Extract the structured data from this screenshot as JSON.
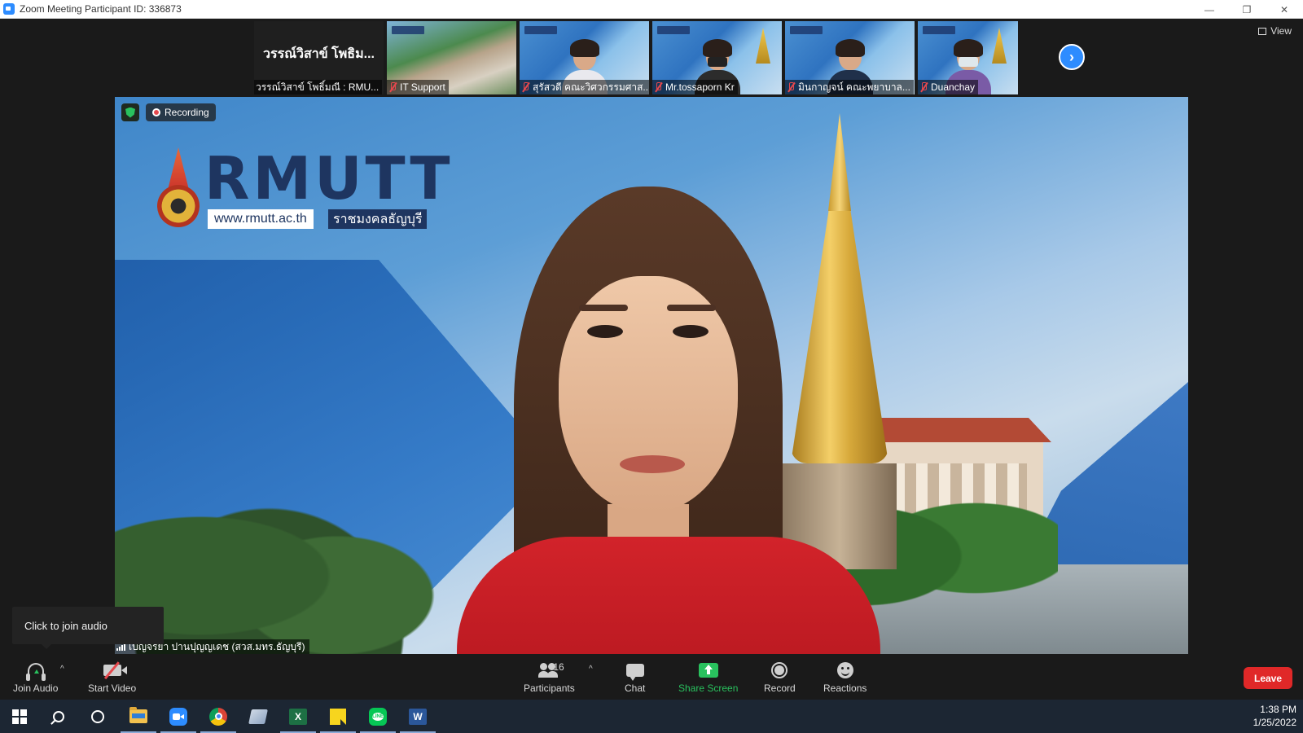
{
  "window": {
    "title": "Zoom Meeting Participant ID: 336873",
    "minimize": "—",
    "restore": "❐",
    "close": "✕"
  },
  "thumbnails": [
    {
      "name": "วรรณ์วิสาข์ โพธิ์มณี : RMU...",
      "big_name": "วรรณ์วิสาข์ โพธิม...",
      "type": "name-only"
    },
    {
      "name": "IT Support",
      "type": "campus",
      "active": true
    },
    {
      "name": "สุรัสวดี คณะวิศวกรรมศาส...",
      "type": "person"
    },
    {
      "name": "Mr.tossaporn Kr",
      "type": "person"
    },
    {
      "name": "มินกาญจน์ คณะพยาบาล...",
      "type": "person"
    },
    {
      "name": "Duanchay",
      "type": "person"
    }
  ],
  "next_button": "›",
  "view_button": "View",
  "main_video": {
    "recording_label": "Recording",
    "speaker_name": "เบญจิรัยา ปานปุญญเดช (สวส.มทร.ธัญบุรี)",
    "logo_text": "RMUTT",
    "logo_url": "www.rmutt.ac.th",
    "logo_thai": "ราชมงคลธัญบุรี"
  },
  "tooltip": "Click to join audio",
  "toolbar": {
    "join_audio": "Join Audio",
    "start_video": "Start Video",
    "participants": "Participants",
    "participants_count": "16",
    "chat": "Chat",
    "share_screen": "Share Screen",
    "record": "Record",
    "reactions": "Reactions",
    "leave": "Leave",
    "caret": "^"
  },
  "taskbar": {
    "time": "1:38 PM",
    "date": "1/25/2022",
    "excel_letter": "X",
    "word_letter": "W",
    "line_text": "LINE"
  },
  "colors": {
    "accent_blue": "#2d8cff",
    "share_green": "#29c15e",
    "leave_red": "#e02828",
    "mute_red": "#e5484d"
  }
}
